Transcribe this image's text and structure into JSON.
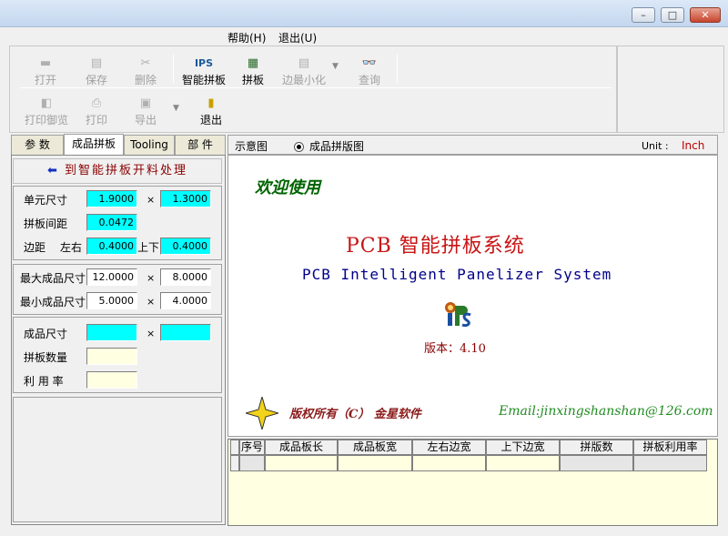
{
  "window": {
    "controls": [
      "–",
      "□",
      "✕"
    ]
  },
  "menu": {
    "items": [
      "帮助(H)",
      "退出(U)"
    ]
  },
  "toolbar": {
    "row1": [
      {
        "label": "打开",
        "icon": "open-folder-icon",
        "enabled": false
      },
      {
        "label": "保存",
        "icon": "save-disk-icon",
        "enabled": false
      },
      {
        "label": "删除",
        "icon": "delete-icon",
        "enabled": false
      },
      {
        "label": "智能拼板",
        "icon": "ips-logo-icon",
        "enabled": true
      },
      {
        "label": "拼板",
        "icon": "panel-grid-icon",
        "enabled": true
      },
      {
        "label": "边最小化",
        "icon": "minimize-edge-icon",
        "enabled": false
      },
      {
        "label": "查询",
        "icon": "binoculars-icon",
        "enabled": false
      }
    ],
    "row2": [
      {
        "label": "打印御览",
        "icon": "print-preview-icon",
        "enabled": false
      },
      {
        "label": "打印",
        "icon": "printer-icon",
        "enabled": false
      },
      {
        "label": "导出",
        "icon": "export-icon",
        "enabled": false
      },
      {
        "label": "退出",
        "icon": "exit-door-icon",
        "enabled": true
      }
    ]
  },
  "left_tabs": [
    "参 数",
    "成品拼板",
    "Tooling",
    "部 件"
  ],
  "left_panel": {
    "banner": "到智能拼板开料处理",
    "unit_size_label": "单元尺寸",
    "unit_w": "1.9000",
    "unit_h": "1.3000",
    "spacing_label": "拼板间距",
    "spacing": "0.0472",
    "margin_label": "边距",
    "lr_label": "左右",
    "lr": "0.4000",
    "ud_label": "上下",
    "ud": "0.4000",
    "max_label": "最大成品尺寸",
    "max_w": "12.0000",
    "max_h": "8.0000",
    "min_label": "最小成品尺寸",
    "min_w": "5.0000",
    "min_h": "4.0000",
    "product_label": "成品尺寸",
    "product_w": "",
    "product_h": "",
    "count_label": "拼板数量",
    "count": "",
    "util_label": "利 用 率",
    "util": "",
    "times": "×"
  },
  "right_panel": {
    "tab_schematic": "示意图",
    "tab_product": "成品拼版图",
    "unit_label": "Unit :",
    "unit_value": "Inch",
    "welcome": "欢迎使用",
    "title": "PCB 智能拼板系统",
    "subtitle": "PCB Intelligent Panelizer System",
    "version": "版本：4.10",
    "copyright": "版权所有（C） 金星软件",
    "email": "Email:jinxingshanshan@126.com"
  },
  "grid": {
    "columns": [
      "序号",
      "成品板长",
      "成品板宽",
      "左右边宽",
      "上下边宽",
      "拼版数",
      "拼板利用率"
    ]
  },
  "colors": {
    "accent_red": "#c81414",
    "title_blue": "#00008b",
    "welcome_green": "#006400",
    "field_cyan": "#00ffff"
  }
}
